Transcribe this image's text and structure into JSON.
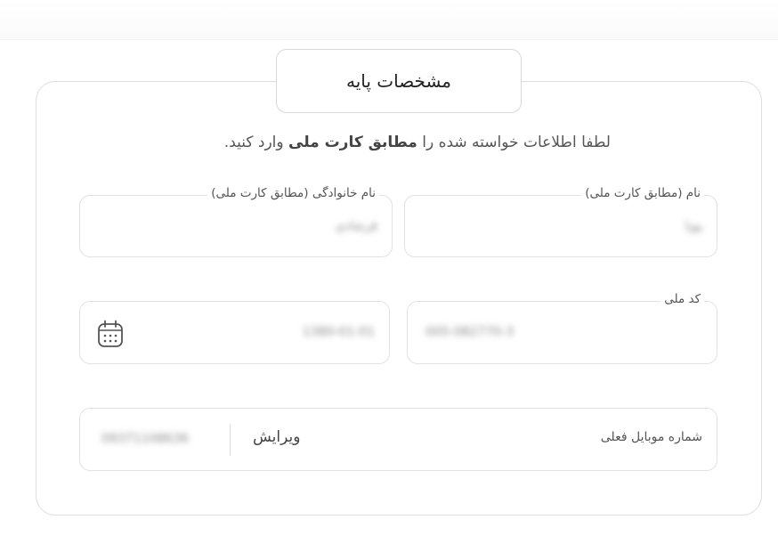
{
  "section": {
    "title": "مشخصات پایه"
  },
  "instruction": {
    "before": "لطفا اطلاعات خواسته شده را ",
    "bold": "مطابق کارت ملی",
    "after": " وارد کنید."
  },
  "fields": {
    "first_name": {
      "label": "نام (مطابق کارت ملی)",
      "value": "پویا"
    },
    "last_name": {
      "label": "نام خانوادگی (مطابق کارت ملی)",
      "value": "فرشادی"
    },
    "national_code": {
      "label": "کد ملی",
      "value": "005-082770-3"
    },
    "birth_date": {
      "value": "1380-01-01",
      "icon": "calendar-icon"
    },
    "mobile": {
      "label": "شماره موبایل فعلی",
      "edit_label": "ویرایش",
      "value": "09371108636"
    }
  }
}
